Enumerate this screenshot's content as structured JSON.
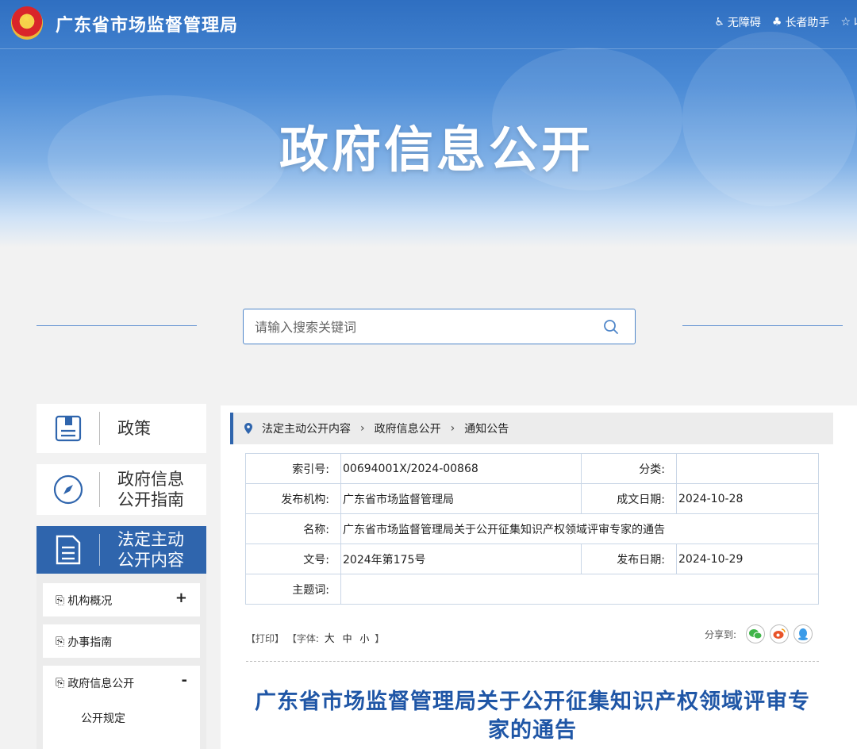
{
  "header": {
    "site_title": "广东省市场监督管理局",
    "banner_title": "政府信息公开",
    "tools": [
      {
        "icon": "accessibility-icon",
        "label": "无障碍"
      },
      {
        "icon": "elder-assist-icon",
        "label": "长者助手"
      },
      {
        "icon": "star-icon",
        "label": "收"
      }
    ]
  },
  "search": {
    "placeholder": "请输入搜索关键词"
  },
  "sidebar": {
    "cards": [
      {
        "label": "政策",
        "icon": "book-icon"
      },
      {
        "label": "政府信息\n公开指南",
        "icon": "compass-icon"
      },
      {
        "label": "法定主动\n公开内容",
        "icon": "document-icon"
      }
    ],
    "items": [
      {
        "label": "机构概况",
        "toggle": "+"
      },
      {
        "label": "办事指南",
        "toggle": ""
      },
      {
        "label": "政府信息公开",
        "toggle": "-"
      }
    ],
    "sub_items": [
      "公开规定"
    ]
  },
  "breadcrumb": [
    "法定主动公开内容",
    "政府信息公开",
    "通知公告"
  ],
  "meta": {
    "index_label": "索引号:",
    "index_value": "00694001X/2024-00868",
    "category_label": "分类:",
    "category_value": "",
    "org_label": "发布机构:",
    "org_value": "广东省市场监督管理局",
    "created_label": "成文日期:",
    "created_value": "2024-10-28",
    "name_label": "名称:",
    "name_value": "广东省市场监督管理局关于公开征集知识产权领域评审专家的通告",
    "docno_label": "文号:",
    "docno_value": "2024年第175号",
    "published_label": "发布日期:",
    "published_value": "2024-10-29",
    "keywords_label": "主题词:",
    "keywords_value": ""
  },
  "article_tools": {
    "print": "【打印】",
    "font_prefix": "【字体:",
    "font_large": "大",
    "font_medium": "中",
    "font_small": "小",
    "font_suffix": "】",
    "share_label": "分享到:"
  },
  "article": {
    "title_line1": "广东省市场监督管理局关于公开征集知识产权领域评审专",
    "title_line2": "家的通告"
  },
  "colors": {
    "brand_blue": "#2f65ad",
    "title_blue": "#1f56a6",
    "wechat_green": "#3fb549",
    "weibo_orange": "#e8542a",
    "qq_blue": "#3a9be8"
  }
}
